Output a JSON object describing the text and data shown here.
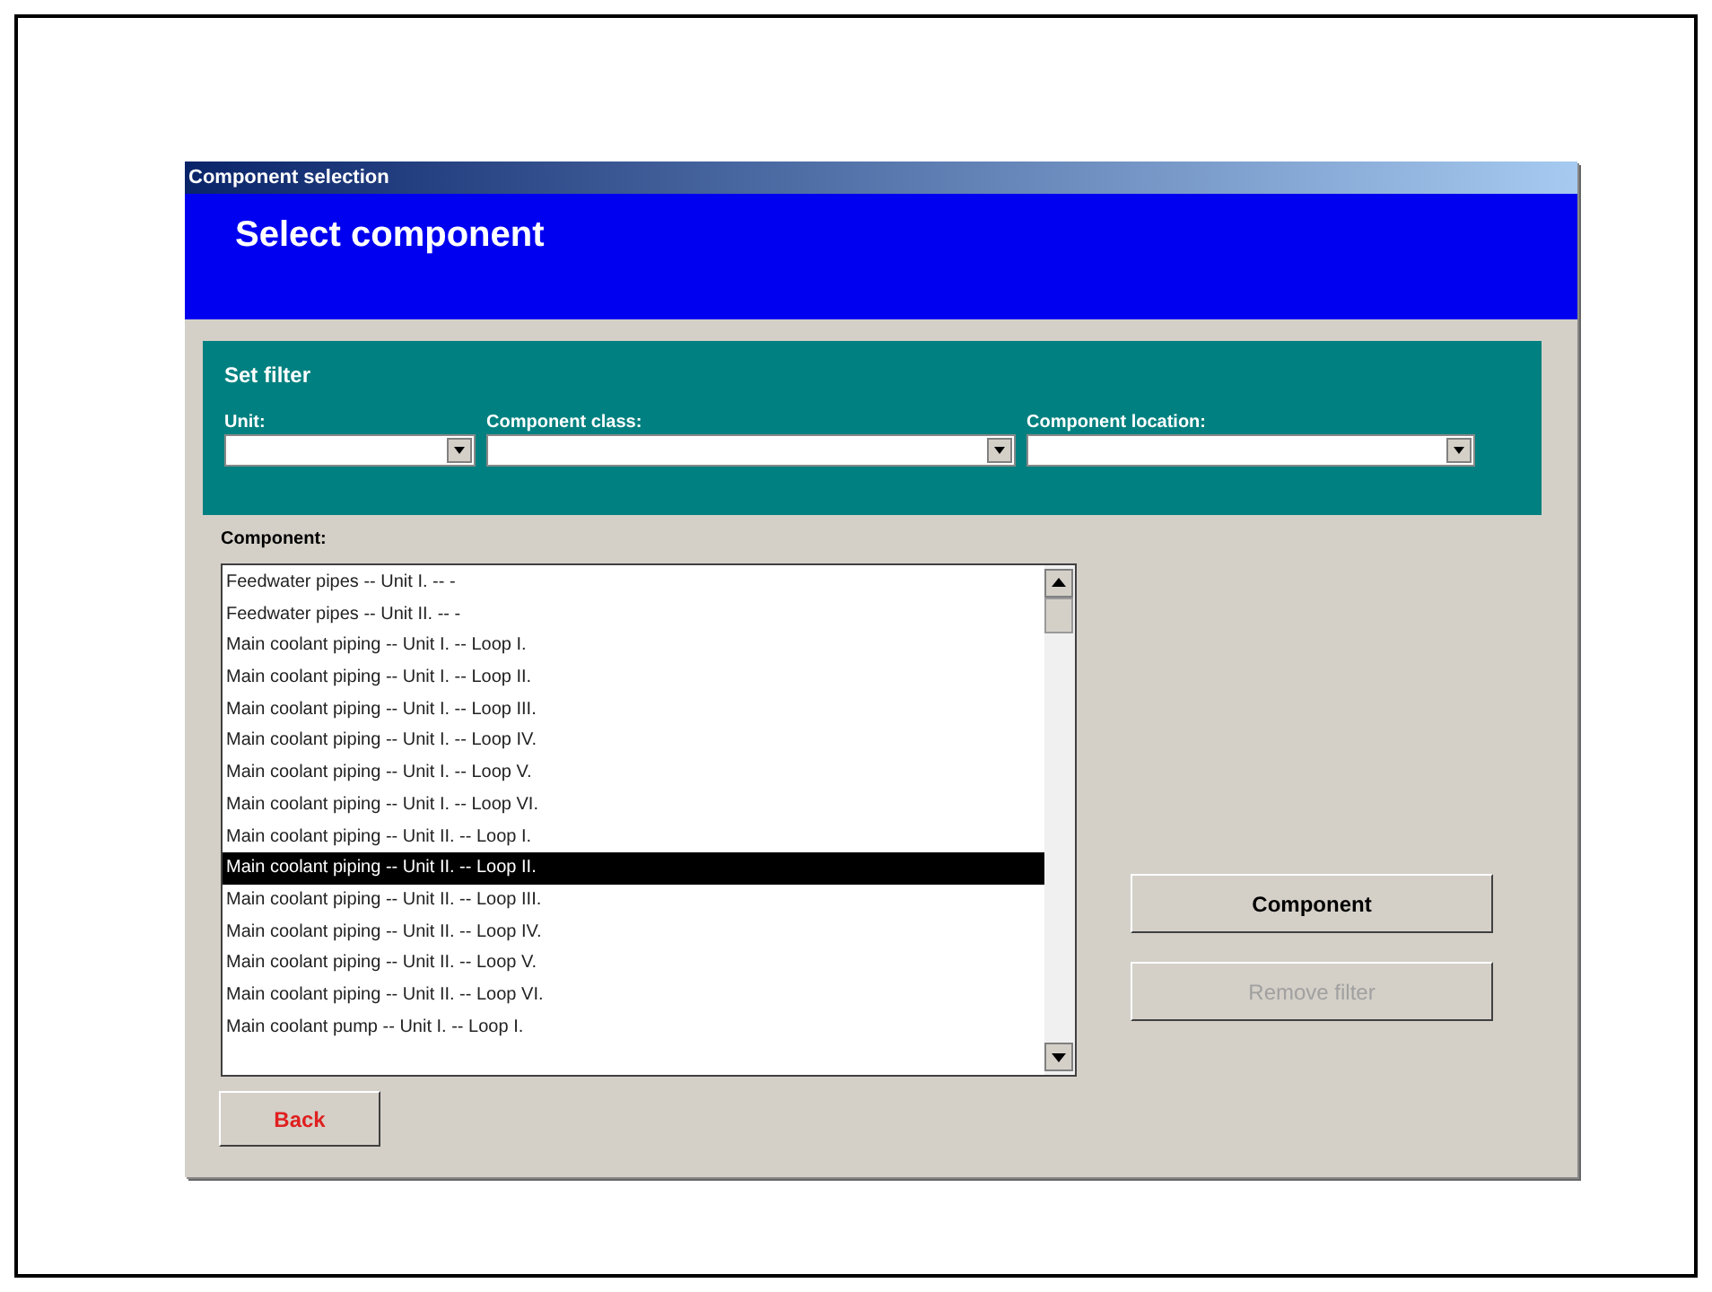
{
  "window": {
    "title": "Component selection"
  },
  "header": {
    "title": "Select component"
  },
  "filter": {
    "title": "Set filter",
    "fields": [
      {
        "label": "Unit:"
      },
      {
        "label": "Component class:"
      },
      {
        "label": "Component location:"
      }
    ]
  },
  "component_list": {
    "label": "Component:",
    "items": [
      {
        "text": "Feedwater pipes -- Unit I. -- -",
        "selected": false
      },
      {
        "text": "Feedwater pipes -- Unit II. -- -",
        "selected": false
      },
      {
        "text": "Main coolant piping -- Unit I. -- Loop I.",
        "selected": false
      },
      {
        "text": "Main coolant piping -- Unit I. -- Loop II.",
        "selected": false
      },
      {
        "text": "Main coolant piping -- Unit I. -- Loop III.",
        "selected": false
      },
      {
        "text": "Main coolant piping -- Unit I. -- Loop IV.",
        "selected": false
      },
      {
        "text": "Main coolant piping -- Unit I. -- Loop V.",
        "selected": false
      },
      {
        "text": "Main coolant piping -- Unit I. -- Loop VI.",
        "selected": false
      },
      {
        "text": "Main coolant piping -- Unit II. -- Loop I.",
        "selected": false
      },
      {
        "text": "Main coolant piping -- Unit II. -- Loop II.",
        "selected": true
      },
      {
        "text": "Main coolant piping -- Unit II. -- Loop III.",
        "selected": false
      },
      {
        "text": "Main coolant piping -- Unit II. -- Loop IV.",
        "selected": false
      },
      {
        "text": "Main coolant piping -- Unit II. -- Loop V.",
        "selected": false
      },
      {
        "text": "Main coolant piping -- Unit II. -- Loop VI.",
        "selected": false
      },
      {
        "text": "Main coolant pump -- Unit I. -- Loop I.",
        "selected": false
      }
    ]
  },
  "buttons": [
    {
      "label": "Component",
      "disabled": false
    },
    {
      "label": "Remove filter",
      "disabled": true
    }
  ],
  "back_button": {
    "label": "Back"
  }
}
